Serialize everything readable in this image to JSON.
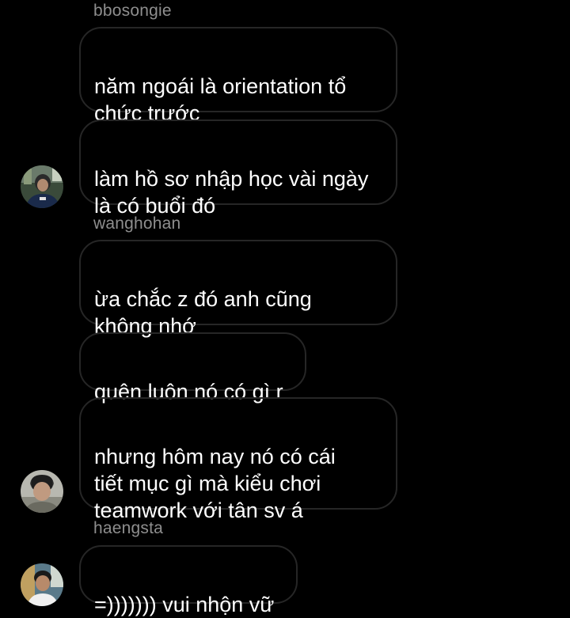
{
  "thread": {
    "groups": [
      {
        "sender": "bbosongie",
        "avatar_icon": "user-avatar-icon",
        "messages": [
          "năm ngoái là orientation tổ\nchức trước",
          "làm hồ sơ nhập học vài ngày\nlà có buổi đó"
        ]
      },
      {
        "sender": "wanghohan",
        "avatar_icon": "user-avatar-icon",
        "messages": [
          "ừa chắc z đó anh cũng\nkhông nhớ",
          "quên luôn nó có gì r",
          "nhưng hôm nay nó có cái\ntiết mục gì mà kiểu chơi\nteamwork với tân sv á"
        ]
      },
      {
        "sender": "haengsta",
        "avatar_icon": "user-avatar-icon",
        "messages": [
          "=))))))) vui nhộn vữ"
        ]
      }
    ]
  },
  "colors": {
    "background": "#000000",
    "bubble_border": "#262626",
    "sender_text": "#8e8e8e",
    "message_text": "#ffffff"
  }
}
